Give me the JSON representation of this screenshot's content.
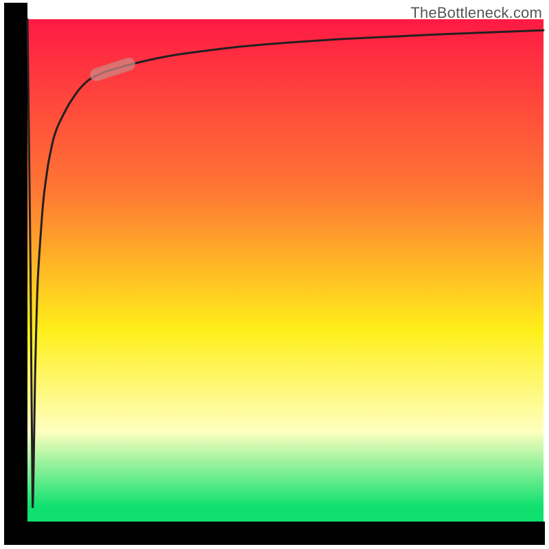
{
  "watermark": "TheBottleneck.com",
  "colors": {
    "axis": "#000000",
    "curve": "#231f20",
    "marker_fill": "#d08a85",
    "marker_stroke": "#c57c77",
    "gradient_top": "#ff1a44",
    "gradient_mid_orange": "#ff7a33",
    "gradient_yellow": "#ffef1a",
    "gradient_pale_yellow": "#ffffbf",
    "gradient_green": "#10e070"
  },
  "chart_data": {
    "type": "line",
    "title": "",
    "xlabel": "",
    "ylabel": "",
    "xlim": [
      0,
      100
    ],
    "ylim": [
      0,
      100
    ],
    "axis_ticks": "none",
    "background_gradient": {
      "direction": "vertical",
      "stops": [
        {
          "offset": 0.0,
          "color": "#ff1a44"
        },
        {
          "offset": 0.35,
          "color": "#ff7a33"
        },
        {
          "offset": 0.62,
          "color": "#ffef1a"
        },
        {
          "offset": 0.82,
          "color": "#ffffbf"
        },
        {
          "offset": 0.97,
          "color": "#10e070"
        }
      ]
    },
    "series": [
      {
        "name": "bottleneck-curve",
        "description": "Initial spike from y=100 down near y=3 at very small x, then logarithmic rise toward y≈98 at x=100",
        "x": [
          0,
          0.6,
          1.0,
          1.5,
          2,
          3,
          4,
          5,
          6,
          8,
          10,
          12,
          15,
          20,
          25,
          30,
          40,
          50,
          60,
          70,
          80,
          90,
          100
        ],
        "y": [
          100,
          50,
          3,
          30,
          48,
          63,
          71,
          76,
          79,
          83,
          86,
          88,
          89.5,
          91,
          92.2,
          93.1,
          94.4,
          95.3,
          96,
          96.5,
          97,
          97.4,
          97.8
        ]
      }
    ],
    "marker": {
      "description": "highlighted pill-shaped segment on the curve",
      "x_center": 16.5,
      "y_center": 90,
      "angle_deg": 18,
      "length": 9,
      "thickness": 2.5,
      "color": "#d08a85"
    }
  }
}
